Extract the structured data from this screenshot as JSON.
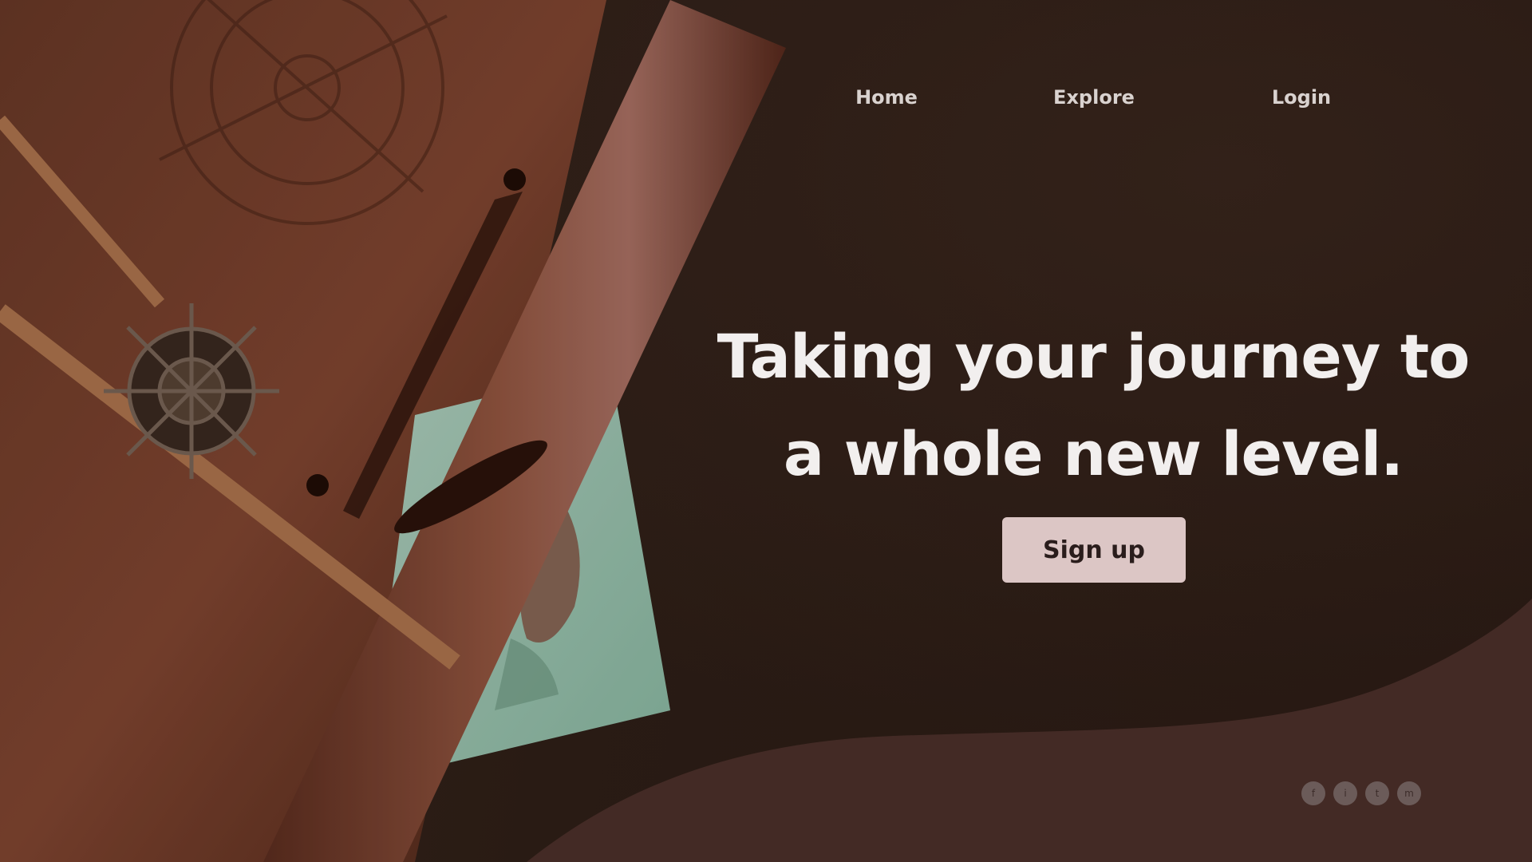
{
  "nav": {
    "items": [
      {
        "label": "Home"
      },
      {
        "label": "Explore"
      },
      {
        "label": "Login"
      }
    ]
  },
  "hero": {
    "headline_line1": "Taking your journey to",
    "headline_line2": "a whole new level.",
    "cta_label": "Sign up"
  },
  "social": {
    "icons": [
      {
        "name": "facebook-icon",
        "glyph": "f"
      },
      {
        "name": "instagram-icon",
        "glyph": "i"
      },
      {
        "name": "twitter-icon",
        "glyph": "t"
      },
      {
        "name": "medium-icon",
        "glyph": "m"
      }
    ]
  },
  "colors": {
    "background": "#2c1e18",
    "wave": "#432a25",
    "cta_bg": "#dcc6c5",
    "cta_text": "#2a1d1c",
    "nav_text": "#d9d2cf",
    "headline_text": "#f2efee"
  }
}
